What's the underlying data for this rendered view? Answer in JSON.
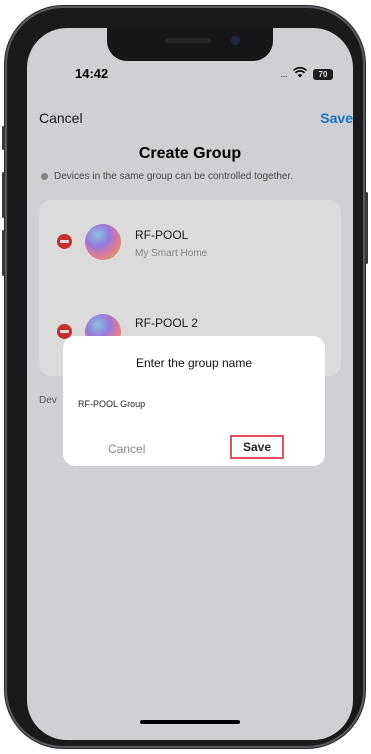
{
  "status_bar": {
    "time": "14:42",
    "signal_dots": "....",
    "wifi_icon": "wifi-icon",
    "battery": "70"
  },
  "nav": {
    "cancel": "Cancel",
    "save": "Save"
  },
  "page": {
    "title": "Create Group",
    "info": "Devices in the same group can be controlled together."
  },
  "devices": [
    {
      "name": "RF-POOL",
      "home": "My Smart Home"
    },
    {
      "name": "RF-POOL 2",
      "home": ""
    }
  ],
  "partial_label": "Dev",
  "dialog": {
    "title": "Enter the group name",
    "input_value": "RF-POOL Group",
    "cancel": "Cancel",
    "save": "Save"
  },
  "colors": {
    "accent": "#1e88e5",
    "remove": "#e5393a",
    "highlight": "#e0525e"
  }
}
